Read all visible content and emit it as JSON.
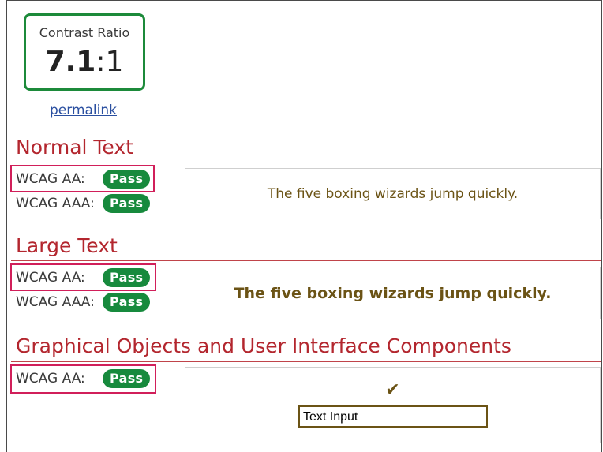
{
  "contrast": {
    "label": "Contrast Ratio",
    "value_bold": "7.1",
    "value_suffix": ":1"
  },
  "permalink": "permalink",
  "sections": {
    "normal": {
      "title": "Normal Text",
      "aa_label": "WCAG AA:",
      "aa_result": "Pass",
      "aaa_label": "WCAG AAA:",
      "aaa_result": "Pass",
      "sample": "The five boxing wizards jump quickly."
    },
    "large": {
      "title": "Large Text",
      "aa_label": "WCAG AA:",
      "aa_result": "Pass",
      "aaa_label": "WCAG AAA:",
      "aaa_result": "Pass",
      "sample": "The five boxing wizards jump quickly."
    },
    "graphical": {
      "title": "Graphical Objects and User Interface Components",
      "aa_label": "WCAG AA:",
      "aa_result": "Pass",
      "check": "✔",
      "input_value": "Text Input"
    }
  },
  "colors": {
    "pass_green": "#178a3d",
    "heading_red": "#b3262e",
    "sample_text": "#6b5315",
    "highlight": "#d11f5a",
    "link": "#2a4fa0"
  }
}
